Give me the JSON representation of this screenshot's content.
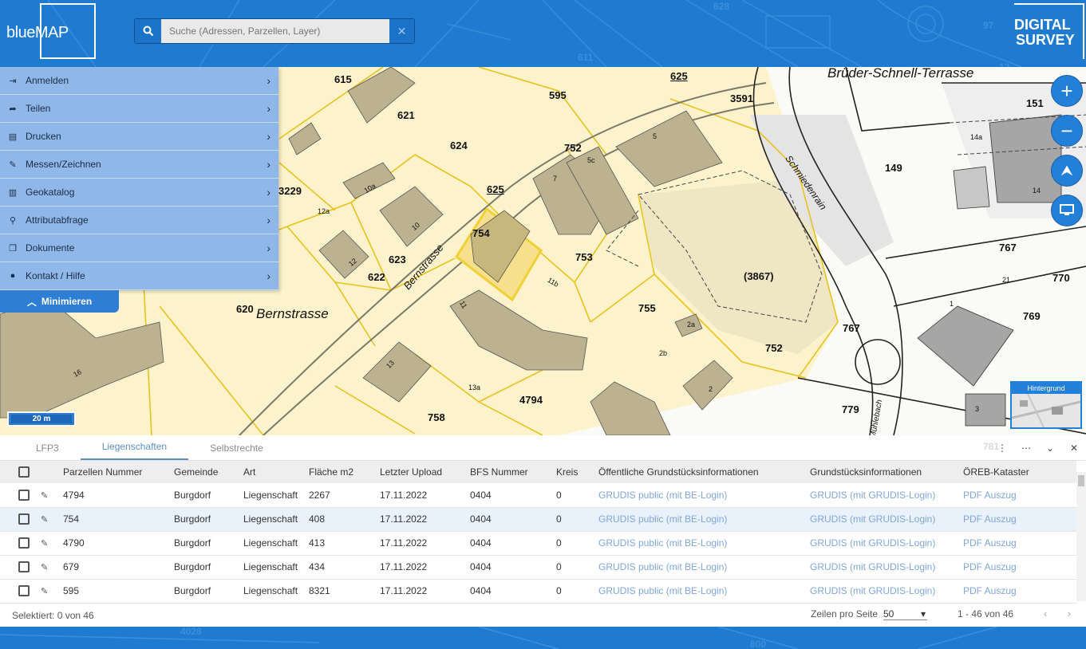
{
  "header": {
    "logo_text": "blueMAP",
    "search_placeholder": "Suche (Adressen, Parzellen, Layer)",
    "brand_line1": "DIGITAL",
    "brand_line2": "SURVEY",
    "bg_labels": [
      "628",
      "611",
      "97",
      "12"
    ]
  },
  "menu": {
    "items": [
      {
        "label": "Anmelden",
        "icon": "sign-in-icon"
      },
      {
        "label": "Teilen",
        "icon": "share-icon"
      },
      {
        "label": "Drucken",
        "icon": "print-icon"
      },
      {
        "label": "Messen/Zeichnen",
        "icon": "ruler-pencil-icon"
      },
      {
        "label": "Geokatalog",
        "icon": "map-icon"
      },
      {
        "label": "Attributabfrage",
        "icon": "search-icon"
      },
      {
        "label": "Dokumente",
        "icon": "copy-icon"
      },
      {
        "label": "Kontakt / Hilfe",
        "icon": "comment-icon"
      }
    ],
    "minimize_label": "Minimieren"
  },
  "map": {
    "parcel_labels": [
      "615",
      "621",
      "595",
      "625",
      "3591",
      "624",
      "625",
      "752",
      "3229",
      "623",
      "622",
      "754",
      "753",
      "620",
      "755",
      "752",
      "4794",
      "758",
      "149",
      "767",
      "770",
      "767",
      "769",
      "779",
      "151",
      "(3867)",
      "16",
      "13",
      "11",
      "10",
      "10a",
      "12",
      "12a",
      "1",
      "5",
      "7",
      "5c",
      "11b",
      "13a",
      "2",
      "2b",
      "2a",
      "14",
      "14a",
      "3",
      "21"
    ],
    "streets": [
      "Bernstrasse",
      "Bernstrasse",
      "Brüder-Schnell-Terrasse",
      "Schmiedenrain",
      "Mühlebach"
    ],
    "scale_label": "20 m",
    "background_label": "Hintergrund",
    "bottom_labels": [
      "4028",
      "800",
      "781"
    ]
  },
  "panel": {
    "tabs": [
      "LFP3",
      "Liegenschaften",
      "Selbstrechte"
    ],
    "active_tab": 1,
    "columns": [
      "Parzellen Nummer",
      "Gemeinde",
      "Art",
      "Fläche m2",
      "Letzter Upload",
      "BFS Nummer",
      "Kreis",
      "Öffentliche Grundstücksinformationen",
      "Grundstücksinformationen",
      "ÖREB-Kataster"
    ],
    "rows": [
      [
        "4794",
        "Burgdorf",
        "Liegenschaft",
        "2267",
        "17.11.2022",
        "0404",
        "0",
        "GRUDIS public (mit BE-Login)",
        "GRUDIS (mit GRUDIS-Login)",
        "PDF Auszug"
      ],
      [
        "754",
        "Burgdorf",
        "Liegenschaft",
        "408",
        "17.11.2022",
        "0404",
        "0",
        "GRUDIS public (mit BE-Login)",
        "GRUDIS (mit GRUDIS-Login)",
        "PDF Auszug"
      ],
      [
        "4790",
        "Burgdorf",
        "Liegenschaft",
        "413",
        "17.11.2022",
        "0404",
        "0",
        "GRUDIS public (mit BE-Login)",
        "GRUDIS (mit GRUDIS-Login)",
        "PDF Auszug"
      ],
      [
        "679",
        "Burgdorf",
        "Liegenschaft",
        "434",
        "17.11.2022",
        "0404",
        "0",
        "GRUDIS public (mit BE-Login)",
        "GRUDIS (mit GRUDIS-Login)",
        "PDF Auszug"
      ],
      [
        "595",
        "Burgdorf",
        "Liegenschaft",
        "8321",
        "17.11.2022",
        "0404",
        "0",
        "GRUDIS public (mit BE-Login)",
        "GRUDIS (mit GRUDIS-Login)",
        "PDF Auszug"
      ]
    ],
    "selected_text": "Selektiert: 0 von 46",
    "rows_per_page_label": "Zeilen pro Seite",
    "rows_per_page_value": "50",
    "range_text": "1 - 46 von 46"
  },
  "colors": {
    "accent": "#1f7bd0",
    "parcel_fill": "#fbf1c6",
    "parcel_line": "#e8c21c",
    "building": "#b9ad8b",
    "link": "#7fa6d6"
  }
}
